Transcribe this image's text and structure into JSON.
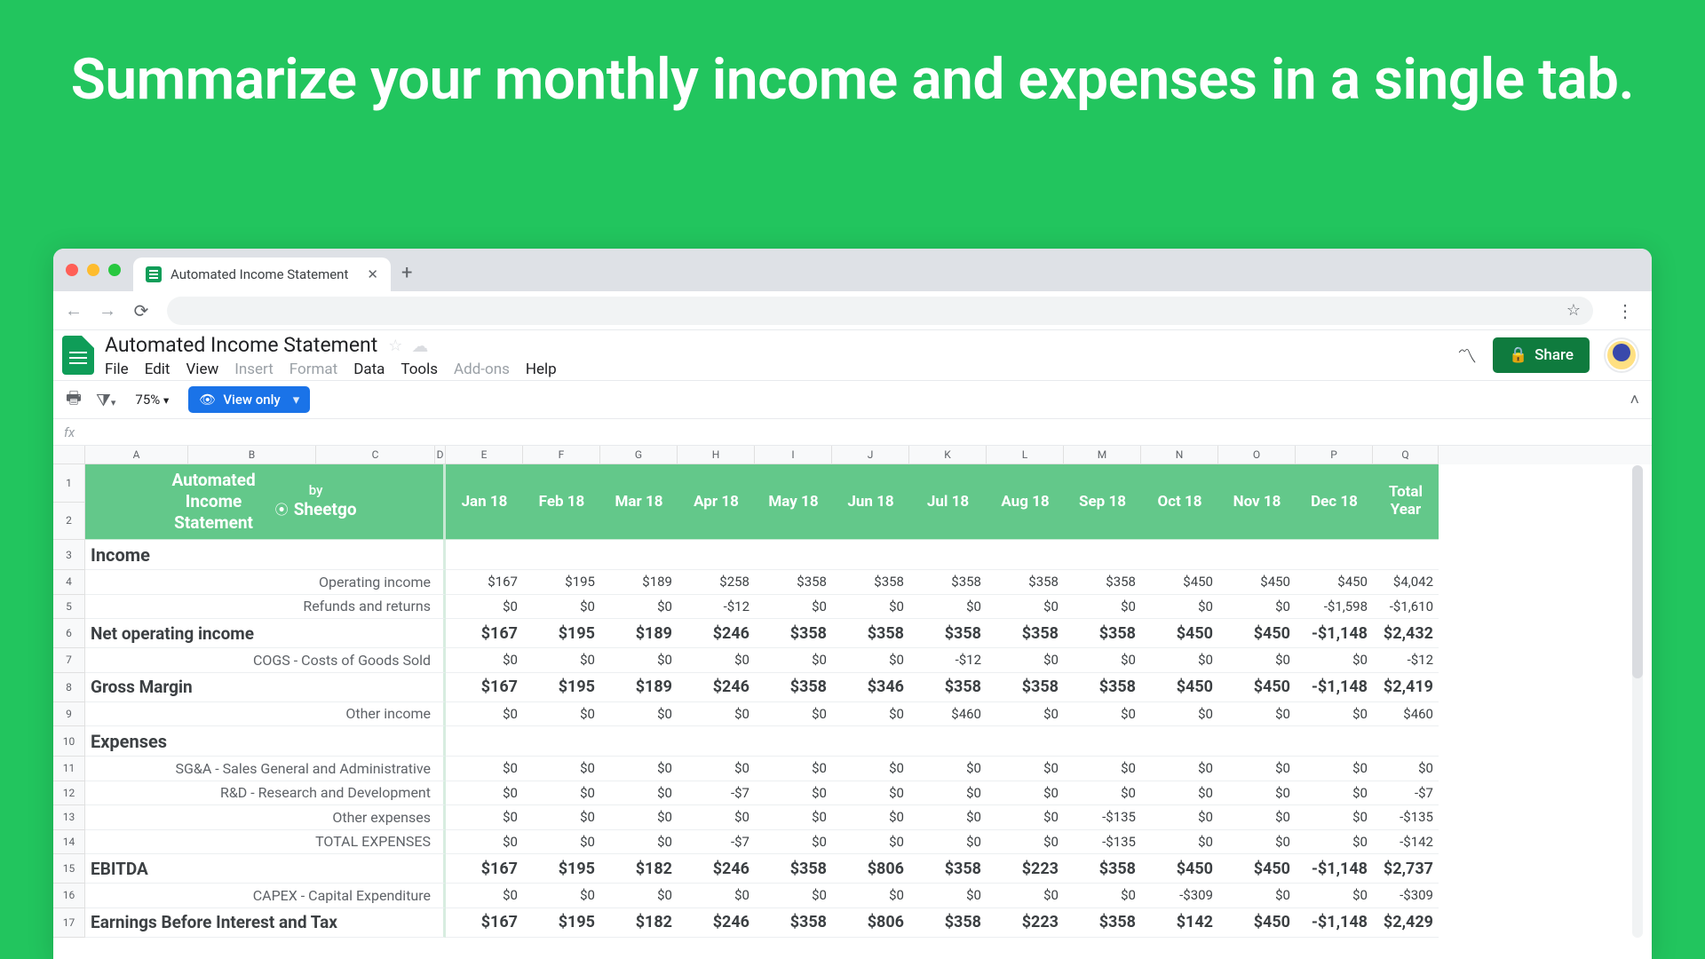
{
  "headline": "Summarize your monthly income and expenses in a single tab.",
  "browser": {
    "tab_title": "Automated Income Statement"
  },
  "doc": {
    "title": "Automated Income Statement",
    "menus": [
      "File",
      "Edit",
      "View",
      "Insert",
      "Format",
      "Data",
      "Tools",
      "Add-ons",
      "Help"
    ],
    "menus_disabled": [
      "Insert",
      "Format",
      "Add-ons"
    ],
    "share_label": "Share",
    "zoom": "75%",
    "view_only": "View only"
  },
  "columns": [
    "A",
    "B",
    "C",
    "D",
    "E",
    "F",
    "G",
    "H",
    "I",
    "J",
    "K",
    "L",
    "M",
    "N",
    "O",
    "P",
    "Q"
  ],
  "months": [
    "Jan 18",
    "Feb 18",
    "Mar 18",
    "Apr 18",
    "May 18",
    "Jun 18",
    "Jul 18",
    "Aug 18",
    "Sep 18",
    "Oct 18",
    "Nov 18",
    "Dec 18"
  ],
  "total_label": "Total Year",
  "header_block": {
    "title_l1": "Automated",
    "title_l2": "Income",
    "title_l3": "Statement",
    "by": "by",
    "brand": "Sheetgo"
  },
  "rows": [
    {
      "n": 3,
      "type": "section",
      "label": "Income",
      "values": [
        "",
        "",
        "",
        "",
        "",
        "",
        "",
        "",
        "",
        "",
        "",
        "",
        ""
      ]
    },
    {
      "n": 4,
      "type": "plain",
      "label": "Operating income",
      "values": [
        "$167",
        "$195",
        "$189",
        "$258",
        "$358",
        "$358",
        "$358",
        "$358",
        "$358",
        "$450",
        "$450",
        "$450",
        "$450"
      ],
      "total": "$4,042"
    },
    {
      "n": 5,
      "type": "plain",
      "label": "Refunds and returns",
      "values": [
        "$0",
        "$0",
        "$0",
        "-$12",
        "$0",
        "$0",
        "$0",
        "$0",
        "$0",
        "$0",
        "$0",
        "-$1,598",
        "$0"
      ],
      "total": "-$1,610"
    },
    {
      "n": 6,
      "type": "bold",
      "label": "Net operating income",
      "values": [
        "$167",
        "$195",
        "$189",
        "$246",
        "$358",
        "$358",
        "$358",
        "$358",
        "$358",
        "$450",
        "$450",
        "-$1,148",
        "$450"
      ],
      "total": "$2,432"
    },
    {
      "n": 7,
      "type": "plain",
      "label": "COGS - Costs of Goods Sold",
      "values": [
        "$0",
        "$0",
        "$0",
        "$0",
        "$0",
        "$0",
        "-$12",
        "$0",
        "$0",
        "$0",
        "$0",
        "$0",
        "$0"
      ],
      "total": "-$12"
    },
    {
      "n": 8,
      "type": "bold",
      "label": "Gross Margin",
      "values": [
        "$167",
        "$195",
        "$189",
        "$246",
        "$358",
        "$346",
        "$358",
        "$358",
        "$358",
        "$450",
        "$450",
        "-$1,148",
        "$450"
      ],
      "total": "$2,419"
    },
    {
      "n": 9,
      "type": "plain",
      "label": "Other income",
      "values": [
        "$0",
        "$0",
        "$0",
        "$0",
        "$0",
        "$0",
        "$460",
        "$0",
        "$0",
        "$0",
        "$0",
        "$0",
        "$0"
      ],
      "total": "$460"
    },
    {
      "n": 10,
      "type": "section",
      "label": "Expenses",
      "values": [
        "",
        "",
        "",
        "",
        "",
        "",
        "",
        "",
        "",
        "",
        "",
        "",
        ""
      ]
    },
    {
      "n": 11,
      "type": "plain",
      "label": "SG&A - Sales General and Administrative",
      "values": [
        "$0",
        "$0",
        "$0",
        "$0",
        "$0",
        "$0",
        "$0",
        "$0",
        "$0",
        "$0",
        "$0",
        "$0",
        "$0"
      ],
      "total": "$0"
    },
    {
      "n": 12,
      "type": "plain",
      "label": "R&D - Research and Development",
      "values": [
        "$0",
        "$0",
        "$0",
        "-$7",
        "$0",
        "$0",
        "$0",
        "$0",
        "$0",
        "$0",
        "$0",
        "$0",
        "$0"
      ],
      "total": "-$7"
    },
    {
      "n": 13,
      "type": "plain",
      "label": "Other expenses",
      "values": [
        "$0",
        "$0",
        "$0",
        "$0",
        "$0",
        "$0",
        "$0",
        "$0",
        "-$135",
        "$0",
        "$0",
        "$0",
        "$0"
      ],
      "total": "-$135"
    },
    {
      "n": 14,
      "type": "plain",
      "label": "TOTAL EXPENSES",
      "values": [
        "$0",
        "$0",
        "$0",
        "-$7",
        "$0",
        "$0",
        "$0",
        "$0",
        "-$135",
        "$0",
        "$0",
        "$0",
        "$0"
      ],
      "total": "-$142"
    },
    {
      "n": 15,
      "type": "bold",
      "label": "EBITDA",
      "values": [
        "$167",
        "$195",
        "$182",
        "$246",
        "$358",
        "$806",
        "$358",
        "$223",
        "$358",
        "$450",
        "$450",
        "-$1,148",
        "$450"
      ],
      "total": "$2,737"
    },
    {
      "n": 16,
      "type": "plain",
      "label": "CAPEX - Capital Expenditure",
      "values": [
        "$0",
        "$0",
        "$0",
        "$0",
        "$0",
        "$0",
        "$0",
        "$0",
        "$0",
        "-$309",
        "$0",
        "$0",
        "$0"
      ],
      "total": "-$309"
    },
    {
      "n": 17,
      "type": "bold",
      "label": "Earnings Before Interest and Tax",
      "values": [
        "$167",
        "$195",
        "$182",
        "$246",
        "$358",
        "$806",
        "$358",
        "$223",
        "$358",
        "$142",
        "$450",
        "-$1,148",
        "$450"
      ],
      "total": "$2,429"
    }
  ]
}
